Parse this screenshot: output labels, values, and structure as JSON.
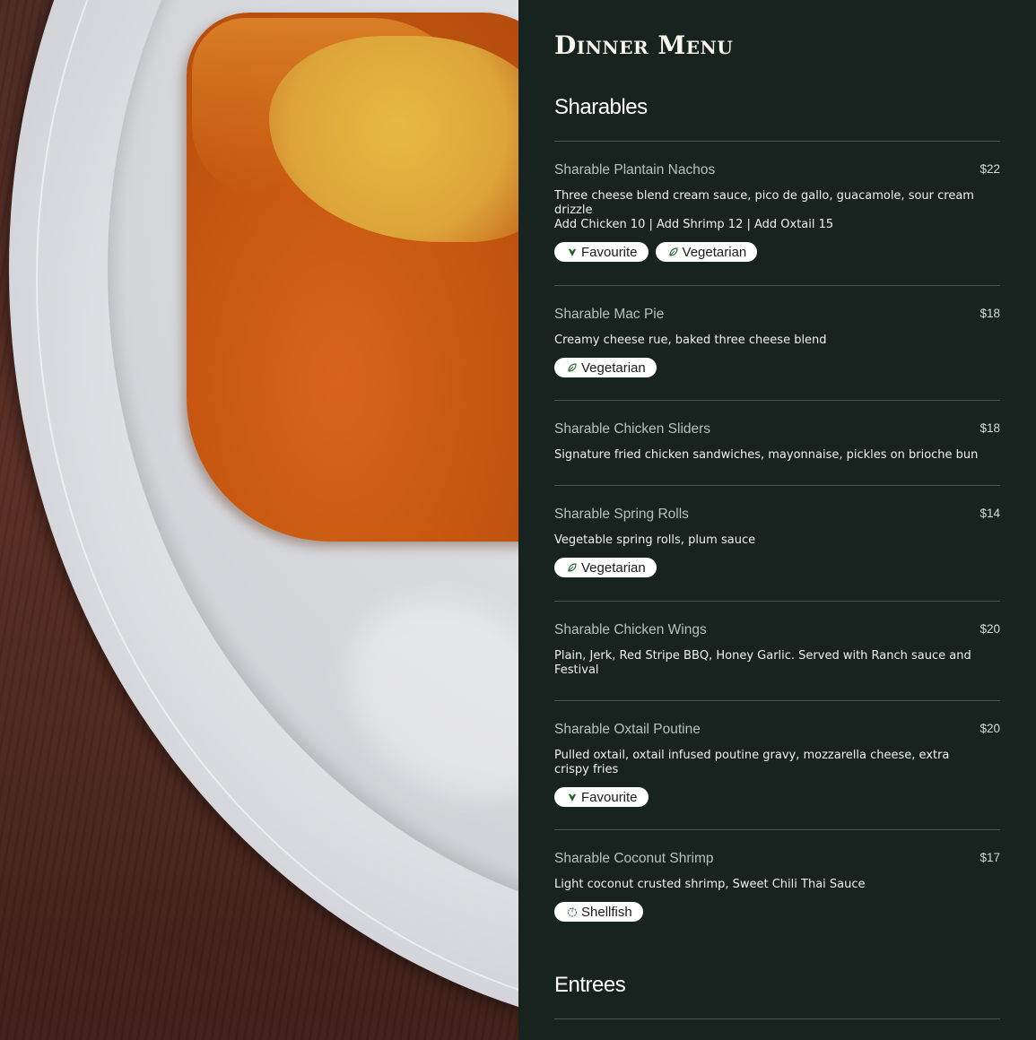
{
  "menu": {
    "title": "Dinner Menu",
    "sections": [
      {
        "title": "Sharables",
        "items": [
          {
            "name": "Sharable Plantain Nachos",
            "price": "$22",
            "description": [
              "Three cheese blend cream sauce, pico de gallo, guacamole, sour cream drizzle",
              "Add Chicken 10 | Add Shrimp 12 | Add Oxtail 15"
            ],
            "tags": [
              {
                "label": "Favourite",
                "icon": "heart-leaf-icon"
              },
              {
                "label": "Vegetarian",
                "icon": "leaf-icon"
              }
            ]
          },
          {
            "name": "Sharable Mac Pie",
            "price": "$18",
            "description": [
              "Creamy cheese rue, baked three cheese blend"
            ],
            "tags": [
              {
                "label": "Vegetarian",
                "icon": "leaf-icon"
              }
            ]
          },
          {
            "name": "Sharable Chicken Sliders",
            "price": "$18",
            "description": [
              "Signature fried chicken sandwiches, mayonnaise, pickles on brioche bun"
            ],
            "tags": []
          },
          {
            "name": "Sharable Spring Rolls",
            "price": "$14",
            "description": [
              "Vegetable spring rolls, plum sauce"
            ],
            "tags": [
              {
                "label": "Vegetarian",
                "icon": "leaf-icon"
              }
            ]
          },
          {
            "name": "Sharable Chicken Wings",
            "price": "$20",
            "description": [
              "Plain, Jerk, Red Stripe BBQ, Honey Garlic. Served with Ranch sauce and Festival"
            ],
            "tags": []
          },
          {
            "name": "Sharable Oxtail Poutine",
            "price": "$20",
            "description": [
              "Pulled oxtail, oxtail infused poutine gravy, mozzarella cheese, extra crispy fries"
            ],
            "tags": [
              {
                "label": "Favourite",
                "icon": "heart-leaf-icon"
              }
            ]
          },
          {
            "name": "Sharable Coconut Shrimp",
            "price": "$17",
            "description": [
              "Light coconut crusted shrimp, Sweet Chili Thai Sauce"
            ],
            "tags": [
              {
                "label": "Shellfish",
                "icon": "shellfish-icon"
              }
            ]
          }
        ]
      },
      {
        "title": "Entrees",
        "items": []
      }
    ]
  },
  "colors": {
    "background": "#17231f",
    "tag_icon_green": "#2e6b3a",
    "favourite_icon": "#1f5a2c"
  }
}
